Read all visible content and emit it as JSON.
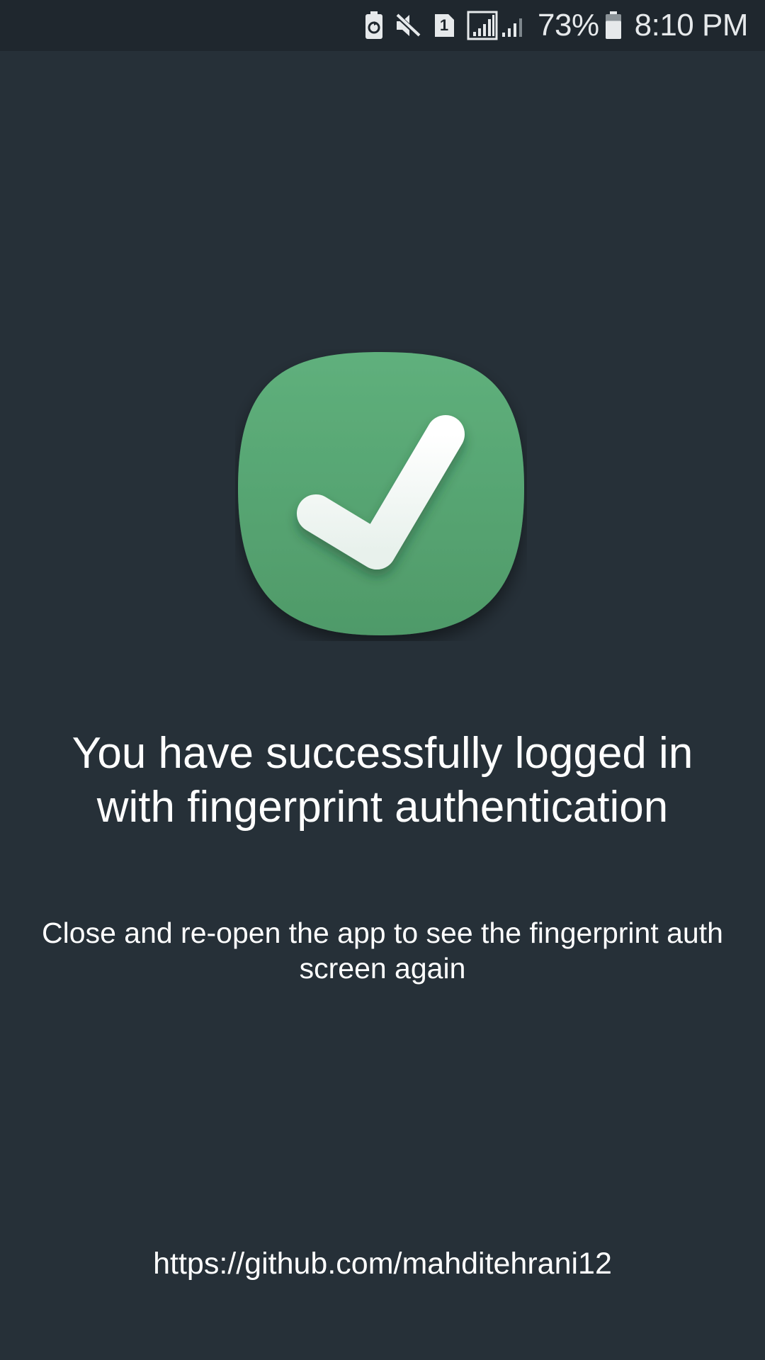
{
  "status_bar": {
    "battery_percent_label": "73%",
    "battery_level": 0.73,
    "time": "8:10 PM",
    "sim_slot_label": "1",
    "icons": [
      "battery-saver-icon",
      "mute-icon",
      "sim-card-icon",
      "signal-sim1-icon",
      "signal-sim2-icon",
      "battery-icon"
    ]
  },
  "success": {
    "icon": "checkmark-icon",
    "badge_color": "#5aa875"
  },
  "main": {
    "title": "You have successfully logged in with fingerprint authentication",
    "instruction": "Close and re-open the app to see the fingerprint auth screen again",
    "link": "https://github.com/mahditehrani12"
  }
}
